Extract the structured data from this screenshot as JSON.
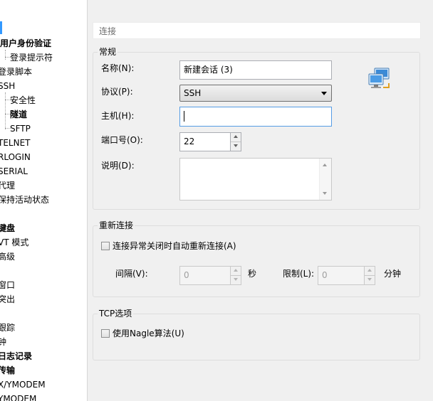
{
  "tree": {
    "items": [
      {
        "label": "用户身份验证",
        "bold": true
      },
      {
        "label": "登录提示符",
        "bold": false
      },
      {
        "label": "登录脚本",
        "bold": false
      },
      {
        "label": "SSH",
        "bold": false
      },
      {
        "label": "安全性",
        "bold": false
      },
      {
        "label": "隧道",
        "bold": true
      },
      {
        "label": "SFTP",
        "bold": false
      },
      {
        "label": "TELNET",
        "bold": false
      },
      {
        "label": "RLOGIN",
        "bold": false
      },
      {
        "label": "SERIAL",
        "bold": false
      },
      {
        "label": "代理",
        "bold": false
      },
      {
        "label": "保持活动状态",
        "bold": false
      },
      {
        "label": "键盘",
        "bold": true
      },
      {
        "label": "VT 模式",
        "bold": false
      },
      {
        "label": "高级",
        "bold": false
      },
      {
        "label": "窗口",
        "bold": false
      },
      {
        "label": "突出",
        "bold": false
      },
      {
        "label": "跟踪",
        "bold": false
      },
      {
        "label": "钟",
        "bold": false
      },
      {
        "label": "日志记录",
        "bold": true
      },
      {
        "label": "传输",
        "bold": true
      },
      {
        "label": "X/YMODEM",
        "bold": false
      },
      {
        "label": "YMODEM",
        "bold": false
      }
    ]
  },
  "header": {
    "title": "连接"
  },
  "general": {
    "legend": "常规",
    "name_label": "名称(N):",
    "name_value": "新建会话 (3)",
    "protocol_label": "协议(P):",
    "protocol_value": "SSH",
    "host_label": "主机(H):",
    "host_value": "",
    "port_label": "端口号(O):",
    "port_value": "22",
    "desc_label": "说明(D):",
    "desc_value": ""
  },
  "reconnect": {
    "legend": "重新连接",
    "auto_reconnect_label": "连接异常关闭时自动重新连接(A)",
    "auto_reconnect_checked": false,
    "interval_label": "间隔(V):",
    "interval_value": "0",
    "interval_unit": "秒",
    "limit_label": "限制(L):",
    "limit_value": "0",
    "limit_unit": "分钟"
  },
  "tcp": {
    "legend": "TCP选项",
    "nagle_label": "使用Nagle算法(U)",
    "nagle_checked": false
  },
  "icons": {
    "session_icon": "network-computers-icon"
  }
}
